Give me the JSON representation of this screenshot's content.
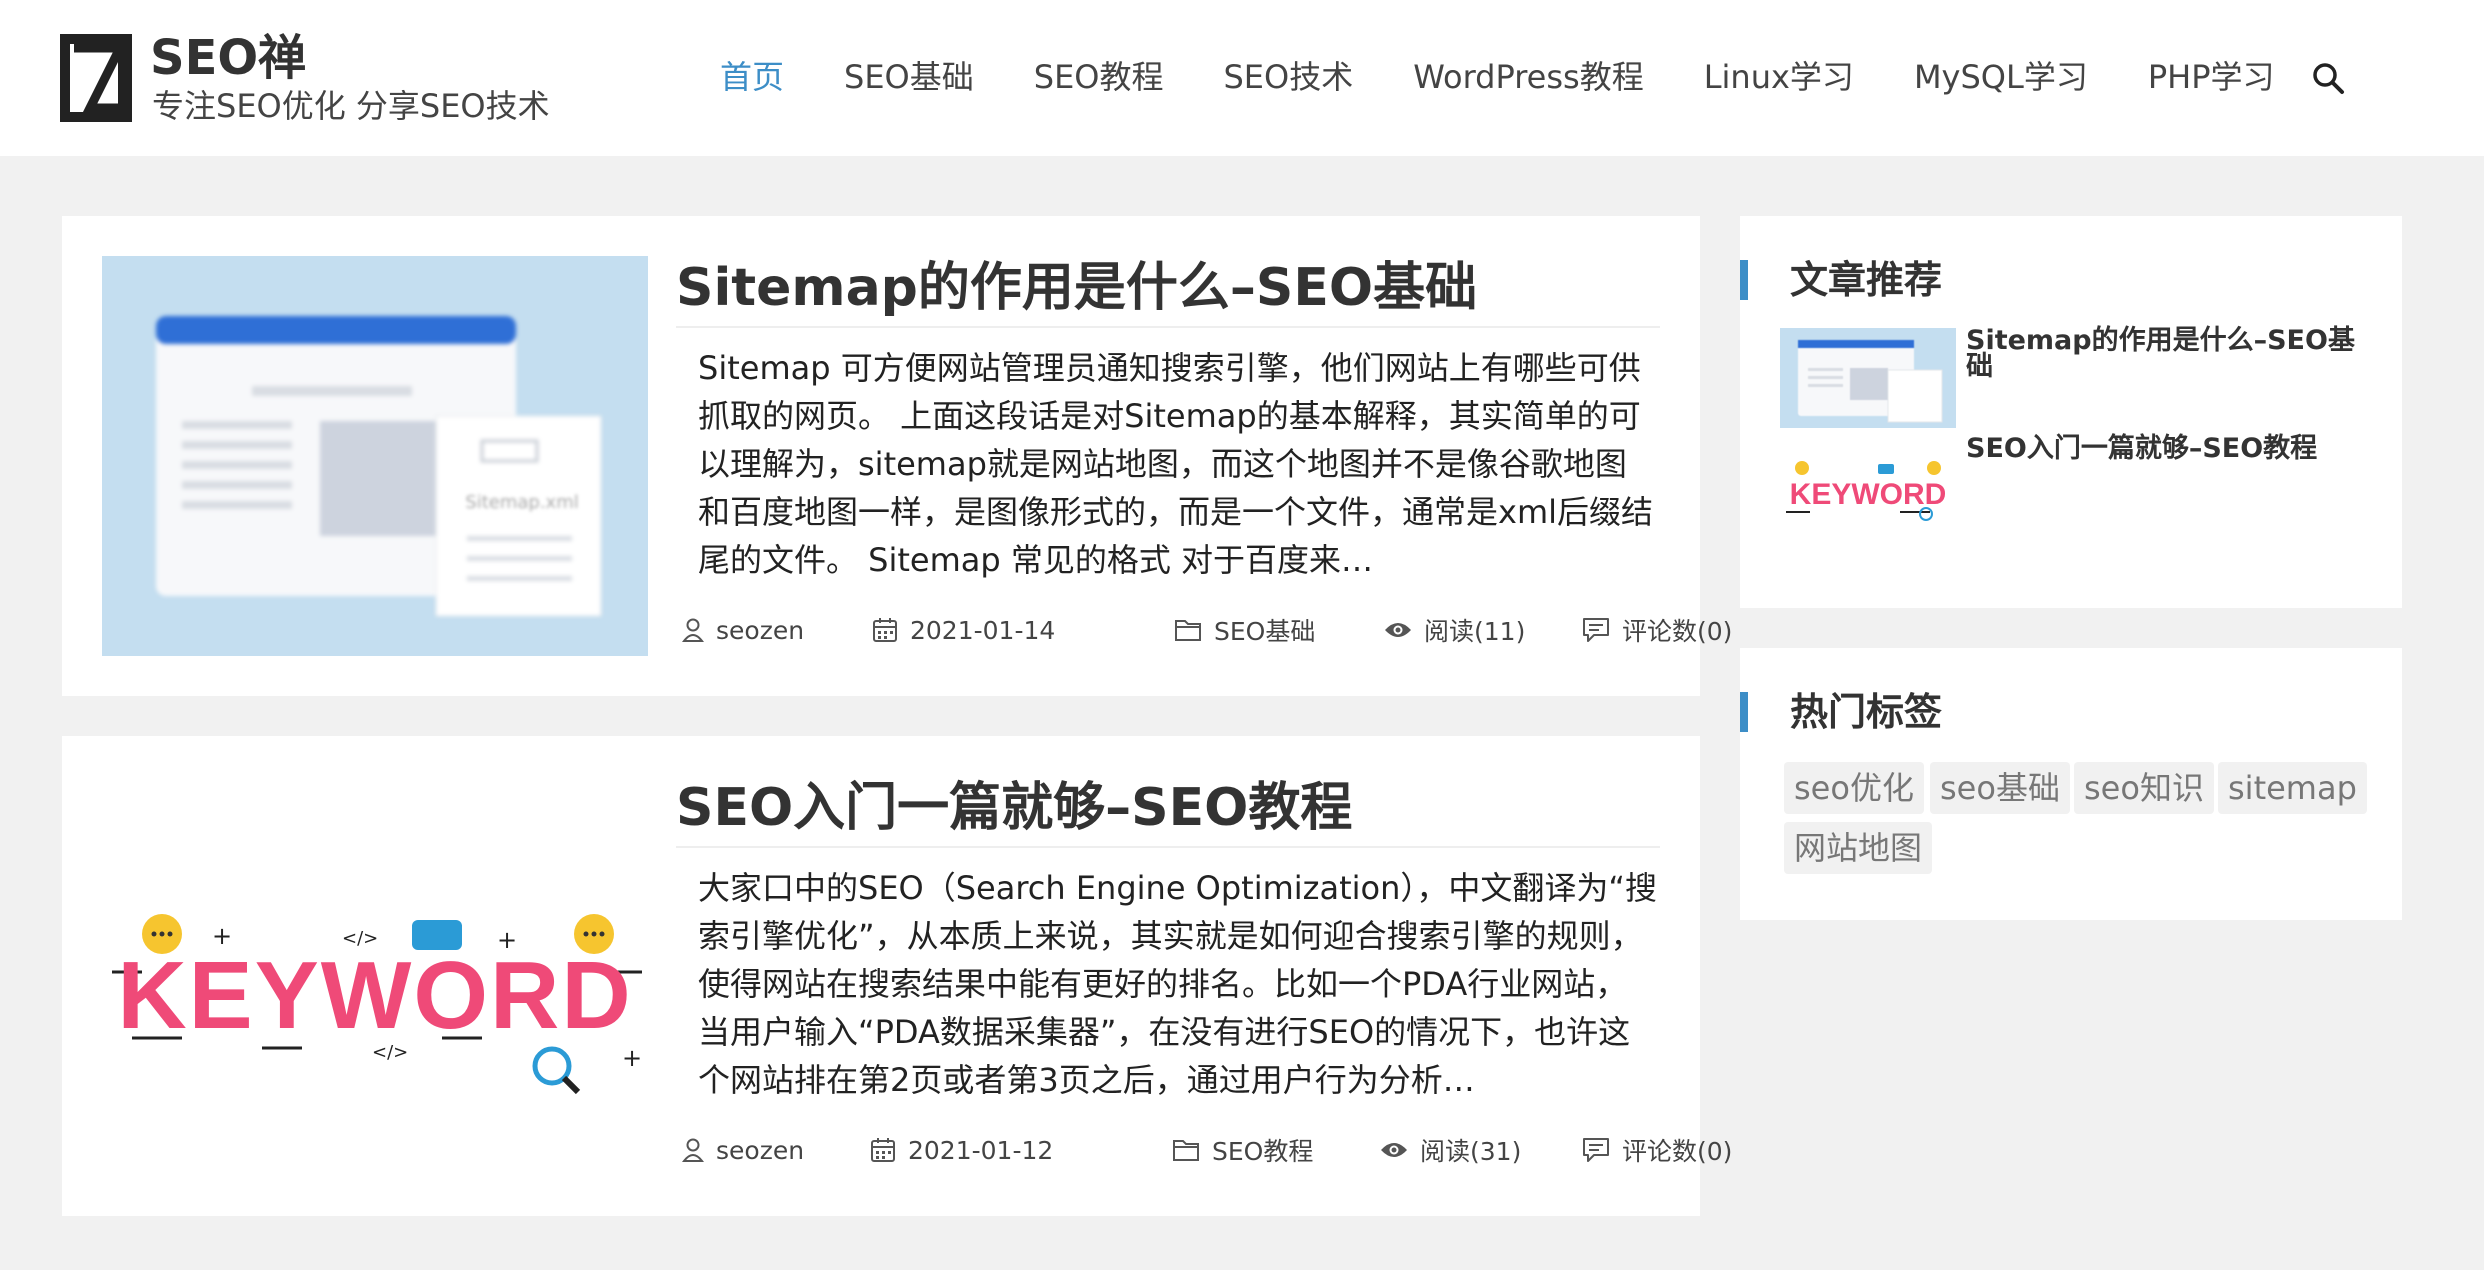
{
  "site": {
    "title": "SEO禅",
    "subtitle": "专注SEO优化 分享SEO技术"
  },
  "nav": {
    "items": [
      "首页",
      "SEO基础",
      "SEO教程",
      "SEO技术",
      "WordPress教程",
      "Linux学习",
      "MySQL学习",
      "PHP学习"
    ],
    "active_index": 0
  },
  "posts": [
    {
      "title": "Sitemap的作用是什么–SEO基础",
      "excerpt": "Sitemap 可方便网站管理员通知搜索引擎，他们网站上有哪些可供抓取的网页。 上面这段话是对Sitemap的基本解释，其实简单的可以理解为，sitemap就是网站地图，而这个地图并不是像谷歌地图和百度地图一样，是图像形式的，而是一个文件，通常是xml后缀结尾的文件。 Sitemap 常见的格式 对于百度来…",
      "author": "seozen",
      "date": "2021-01-14",
      "category": "SEO基础",
      "views": "阅读(11)",
      "comments": "评论数(0)",
      "thumb_text": "Sitemap.xml"
    },
    {
      "title": "SEO入门一篇就够–SEO教程",
      "excerpt": "大家口中的SEO（Search Engine Optimization），中文翻译为“搜索引擎优化”，从本质上来说，其实就是如何迎合搜索引擎的规则，使得网站在搜索结果中能有更好的排名。比如一个PDA行业网站，当用户输入“PDA数据采集器”，在没有进行SEO的情况下，也许这个网站排在第2页或者第3页之后，通过用户行为分析…",
      "author": "seozen",
      "date": "2021-01-12",
      "category": "SEO教程",
      "views": "阅读(31)",
      "comments": "评论数(0)",
      "thumb_text": "KEYWORD"
    }
  ],
  "sidebar": {
    "recommend_title": "文章推荐",
    "recommend": [
      {
        "title": "Sitemap的作用是什么–SEO基础"
      },
      {
        "title": "SEO入门一篇就够–SEO教程"
      }
    ],
    "tags_title": "热门标签",
    "tags": [
      "seo优化",
      "seo基础",
      "seo知识",
      "sitemap",
      "网站地图"
    ]
  },
  "colors": {
    "accent": "#3d8ec7",
    "background": "#f1f1f1",
    "keyword_pink": "#ef4a78",
    "thumb_blue": "#c4def0"
  },
  "icons": [
    "logo-z-icon",
    "search-icon",
    "user-icon",
    "calendar-icon",
    "folder-icon",
    "eye-icon",
    "comment-icon"
  ]
}
